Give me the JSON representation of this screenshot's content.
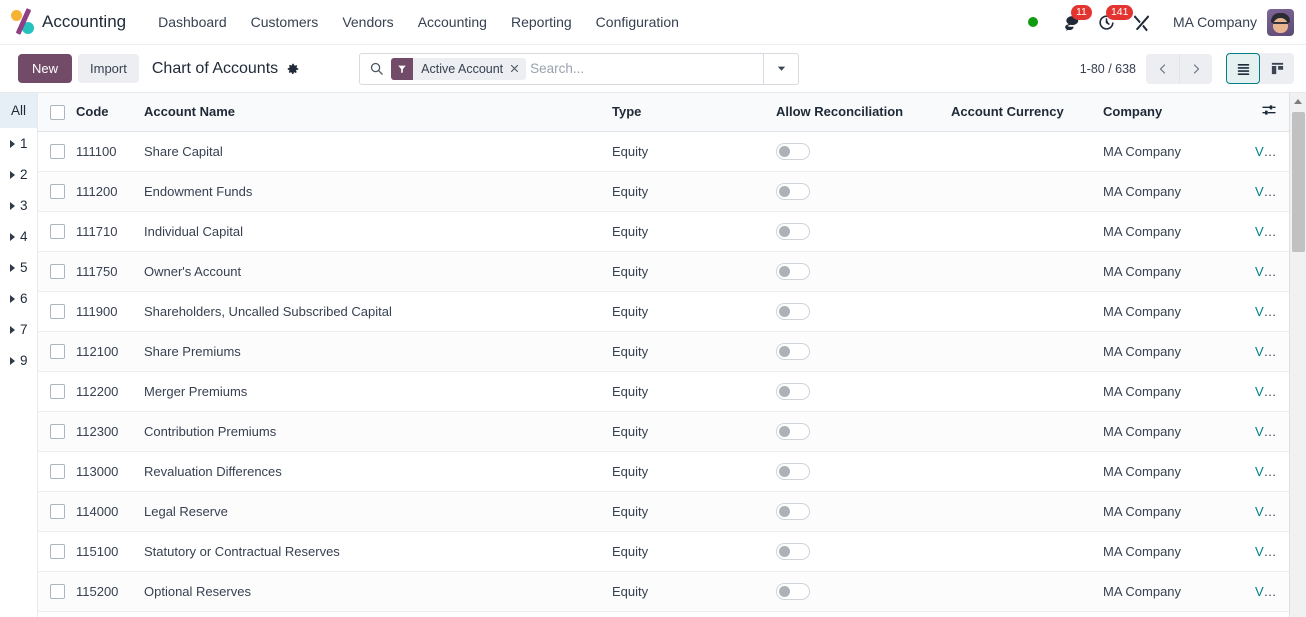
{
  "navbar": {
    "brand": "Accounting",
    "menu": [
      {
        "label": "Dashboard"
      },
      {
        "label": "Customers"
      },
      {
        "label": "Vendors"
      },
      {
        "label": "Accounting"
      },
      {
        "label": "Reporting"
      },
      {
        "label": "Configuration"
      }
    ],
    "status_icon": "online-status-dot",
    "messages": {
      "icon": "messages-icon",
      "count": "11"
    },
    "activities": {
      "icon": "activities-clock-icon",
      "count": "141"
    },
    "apps_icon": "tools-icon",
    "company": "MA Company",
    "avatar_icon": "user-avatar"
  },
  "controlpanel": {
    "new_label": "New",
    "import_label": "Import",
    "title": "Chart of Accounts",
    "gear_icon": "gear-icon",
    "search": {
      "search_icon": "search-icon",
      "facet_icon": "filter-icon",
      "facet_label": "Active Account",
      "facet_remove_icon": "close-icon",
      "placeholder": "Search...",
      "value": "",
      "caret_icon": "chevron-down-icon"
    },
    "pager": {
      "range": "1-80 / 638",
      "prev_icon": "chevron-left-icon",
      "next_icon": "chevron-right-icon"
    },
    "views": {
      "list_icon": "list-view-icon",
      "kanban_icon": "kanban-view-icon",
      "active": "list"
    }
  },
  "sidepanel": {
    "all_label": "All",
    "groups": [
      {
        "label": "1"
      },
      {
        "label": "2"
      },
      {
        "label": "3"
      },
      {
        "label": "4"
      },
      {
        "label": "5"
      },
      {
        "label": "6"
      },
      {
        "label": "7"
      },
      {
        "label": "9"
      }
    ]
  },
  "table": {
    "columns": [
      {
        "key": "code",
        "label": "Code"
      },
      {
        "key": "name",
        "label": "Account Name"
      },
      {
        "key": "type",
        "label": "Type"
      },
      {
        "key": "reconciliation",
        "label": "Allow Reconciliation"
      },
      {
        "key": "currency",
        "label": "Account Currency"
      },
      {
        "key": "company",
        "label": "Company"
      }
    ],
    "optional_columns_icon": "sliders-icon",
    "view_label": "View",
    "rows": [
      {
        "code": "111100",
        "name": "Share Capital",
        "type": "Equity",
        "reconciliation": false,
        "currency": "",
        "company": "MA Company"
      },
      {
        "code": "111200",
        "name": "Endowment Funds",
        "type": "Equity",
        "reconciliation": false,
        "currency": "",
        "company": "MA Company"
      },
      {
        "code": "111710",
        "name": "Individual Capital",
        "type": "Equity",
        "reconciliation": false,
        "currency": "",
        "company": "MA Company"
      },
      {
        "code": "111750",
        "name": "Owner's Account",
        "type": "Equity",
        "reconciliation": false,
        "currency": "",
        "company": "MA Company"
      },
      {
        "code": "111900",
        "name": "Shareholders, Uncalled Subscribed Capital",
        "type": "Equity",
        "reconciliation": false,
        "currency": "",
        "company": "MA Company"
      },
      {
        "code": "112100",
        "name": "Share Premiums",
        "type": "Equity",
        "reconciliation": false,
        "currency": "",
        "company": "MA Company"
      },
      {
        "code": "112200",
        "name": "Merger Premiums",
        "type": "Equity",
        "reconciliation": false,
        "currency": "",
        "company": "MA Company"
      },
      {
        "code": "112300",
        "name": "Contribution Premiums",
        "type": "Equity",
        "reconciliation": false,
        "currency": "",
        "company": "MA Company"
      },
      {
        "code": "113000",
        "name": "Revaluation Differences",
        "type": "Equity",
        "reconciliation": false,
        "currency": "",
        "company": "MA Company"
      },
      {
        "code": "114000",
        "name": "Legal Reserve",
        "type": "Equity",
        "reconciliation": false,
        "currency": "",
        "company": "MA Company"
      },
      {
        "code": "115100",
        "name": "Statutory or Contractual Reserves",
        "type": "Equity",
        "reconciliation": false,
        "currency": "",
        "company": "MA Company"
      },
      {
        "code": "115200",
        "name": "Optional Reserves",
        "type": "Equity",
        "reconciliation": false,
        "currency": "",
        "company": "MA Company"
      }
    ]
  },
  "colors": {
    "primary": "#714b67",
    "accent_teal": "#017e84",
    "badge_red": "#e3342f",
    "status_green": "#0f9d0f"
  }
}
